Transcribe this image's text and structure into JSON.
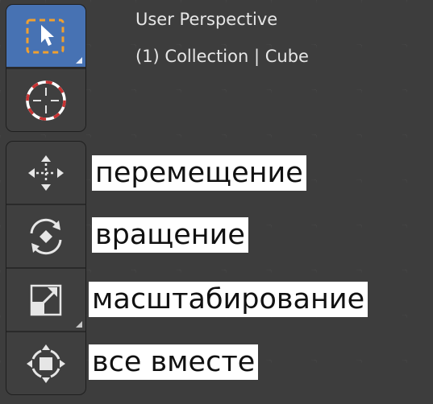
{
  "viewport": {
    "perspective": "User Perspective",
    "collection_info": "(1) Collection | Cube"
  },
  "toolbar": {
    "select": {
      "icon": "select-box-icon",
      "active": true
    },
    "cursor": {
      "icon": "3d-cursor-icon"
    },
    "move": {
      "icon": "move-arrows-icon"
    },
    "rotate": {
      "icon": "rotate-icon"
    },
    "scale": {
      "icon": "scale-icon"
    },
    "transform": {
      "icon": "transform-icon"
    }
  },
  "annotations": {
    "move": "перемещение",
    "rotate": "вращение",
    "scale": "масштабирование",
    "transform": "все вместе"
  },
  "colors": {
    "active_button": "#4772b3",
    "select_box": "#f0a030",
    "cursor_red": "#c83232"
  }
}
